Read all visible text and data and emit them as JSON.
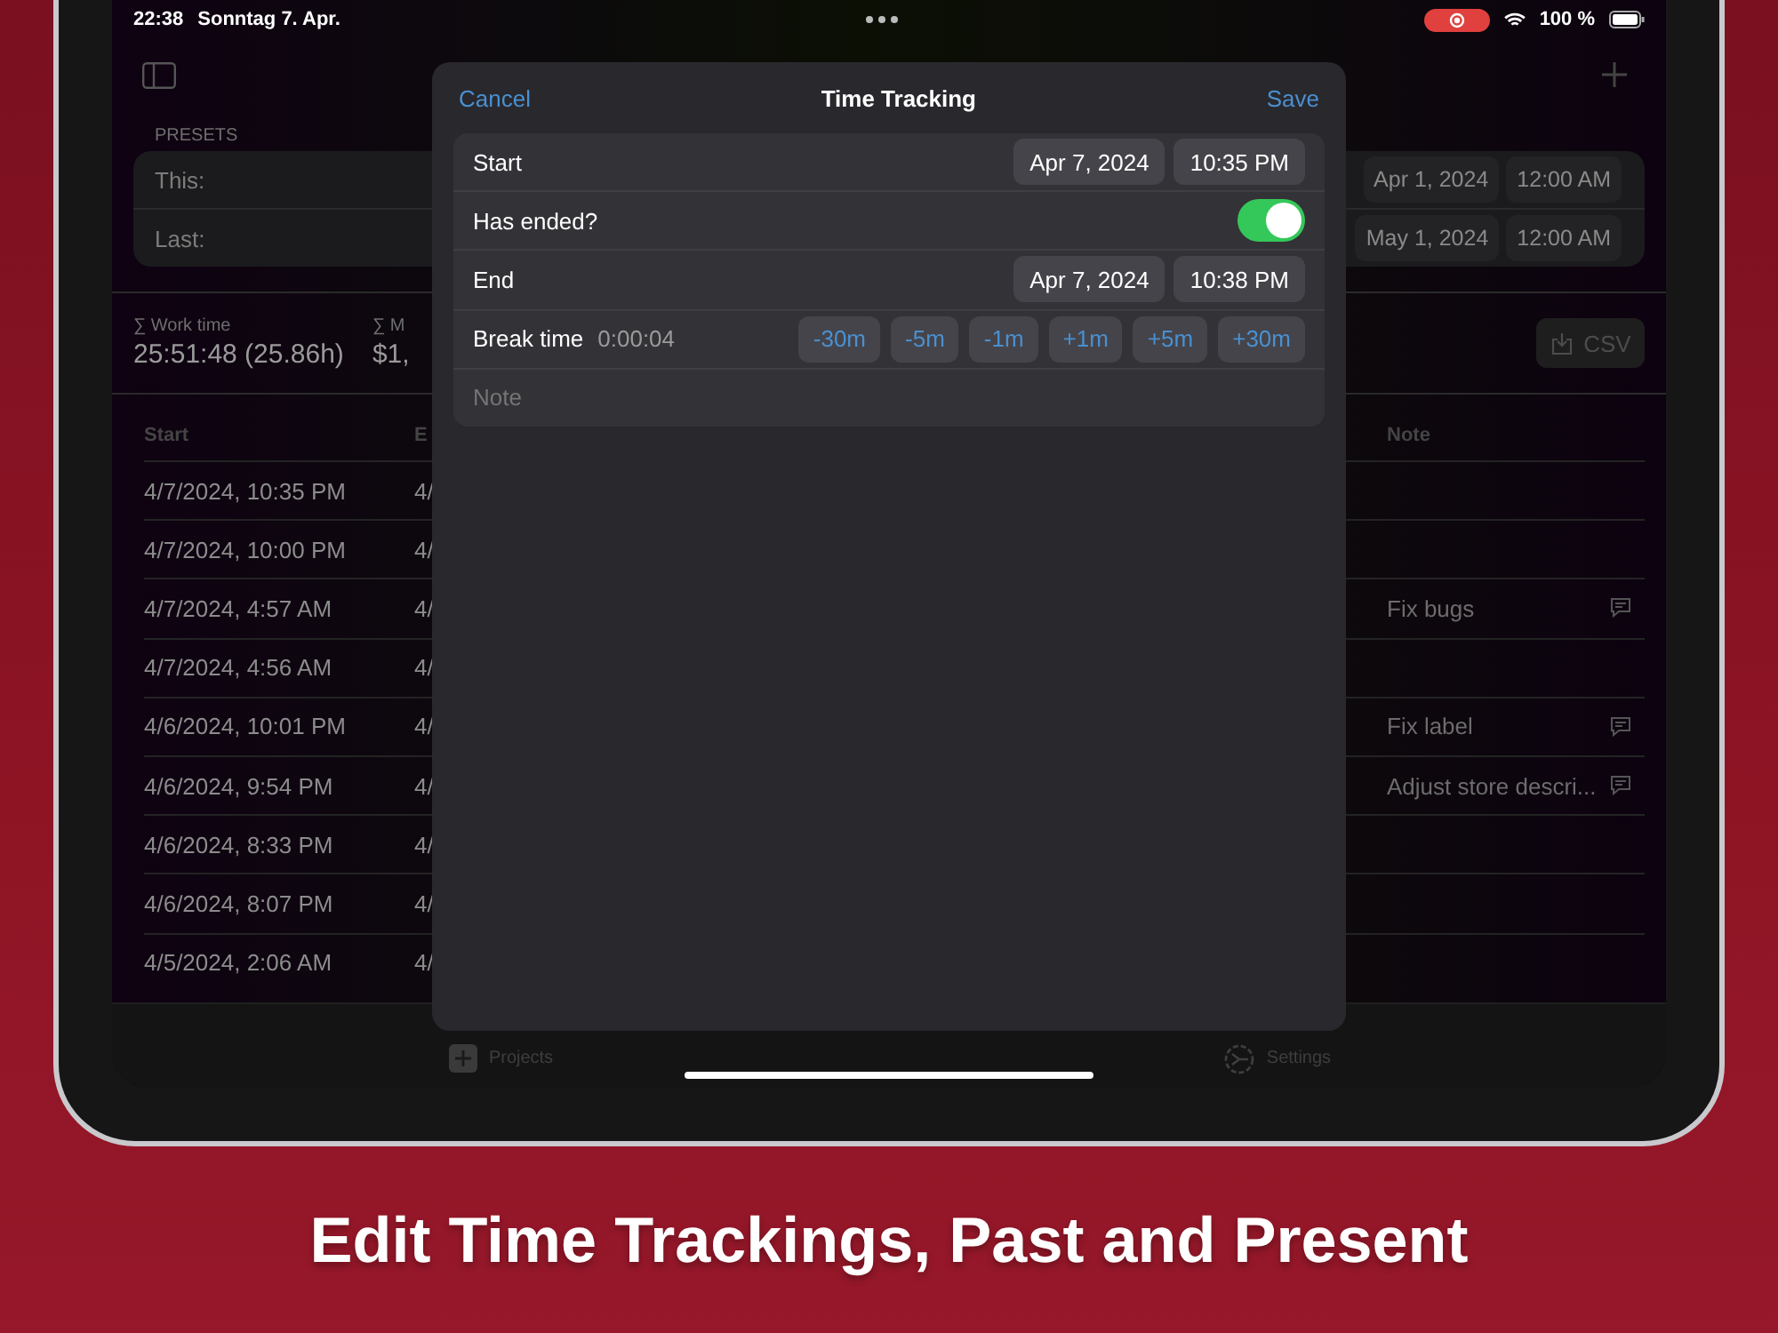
{
  "status_bar": {
    "time": "22:38",
    "date": "Sonntag 7. Apr.",
    "battery": "100 %"
  },
  "presets": {
    "heading": "PRESETS",
    "rows": [
      {
        "label": "This:",
        "date": "Apr 1, 2024",
        "time": "12:00 AM"
      },
      {
        "label": "Last:",
        "date": "May 1, 2024",
        "time": "12:00 AM"
      }
    ]
  },
  "stats": [
    {
      "label": "∑ Work time",
      "value": "25:51:48 (25.86h)"
    },
    {
      "label": "∑ M",
      "value": "$1,"
    }
  ],
  "export_button": "CSV",
  "table": {
    "columns": [
      "Start",
      "E",
      "Note"
    ],
    "rows": [
      {
        "start": "4/7/2024, 10:35 PM",
        "end": "4/",
        "note": ""
      },
      {
        "start": "4/7/2024, 10:00 PM",
        "end": "4/",
        "note": ""
      },
      {
        "start": "4/7/2024, 4:57 AM",
        "end": "4/",
        "note": "Fix bugs"
      },
      {
        "start": "4/7/2024, 4:56 AM",
        "end": "4/",
        "note": ""
      },
      {
        "start": "4/6/2024, 10:01 PM",
        "end": "4/",
        "note": "Fix label"
      },
      {
        "start": "4/6/2024, 9:54 PM",
        "end": "4/",
        "note": "Adjust store descri..."
      },
      {
        "start": "4/6/2024, 8:33 PM",
        "end": "4/",
        "note": ""
      },
      {
        "start": "4/6/2024, 8:07 PM",
        "end": "4/",
        "note": ""
      },
      {
        "start": "4/5/2024, 2:06 AM",
        "end": "4/",
        "note": ""
      }
    ]
  },
  "tab_bar": [
    {
      "label": "Projects",
      "kind": "projects"
    },
    {
      "label": "Settings",
      "kind": "settings"
    }
  ],
  "dialog": {
    "cancel": "Cancel",
    "title": "Time Tracking",
    "save": "Save",
    "start": {
      "label": "Start",
      "date": "Apr 7, 2024",
      "time": "10:35 PM"
    },
    "has_ended": {
      "label": "Has ended?",
      "on": true
    },
    "end": {
      "label": "End",
      "date": "Apr 7, 2024",
      "time": "10:38 PM"
    },
    "break": {
      "label": "Break time",
      "value": "0:00:04",
      "adjust_buttons": [
        "-30m",
        "-5m",
        "-1m",
        "+1m",
        "+5m",
        "+30m"
      ]
    },
    "note": {
      "placeholder": "Note"
    }
  },
  "caption": "Edit Time Trackings, Past and Present"
}
